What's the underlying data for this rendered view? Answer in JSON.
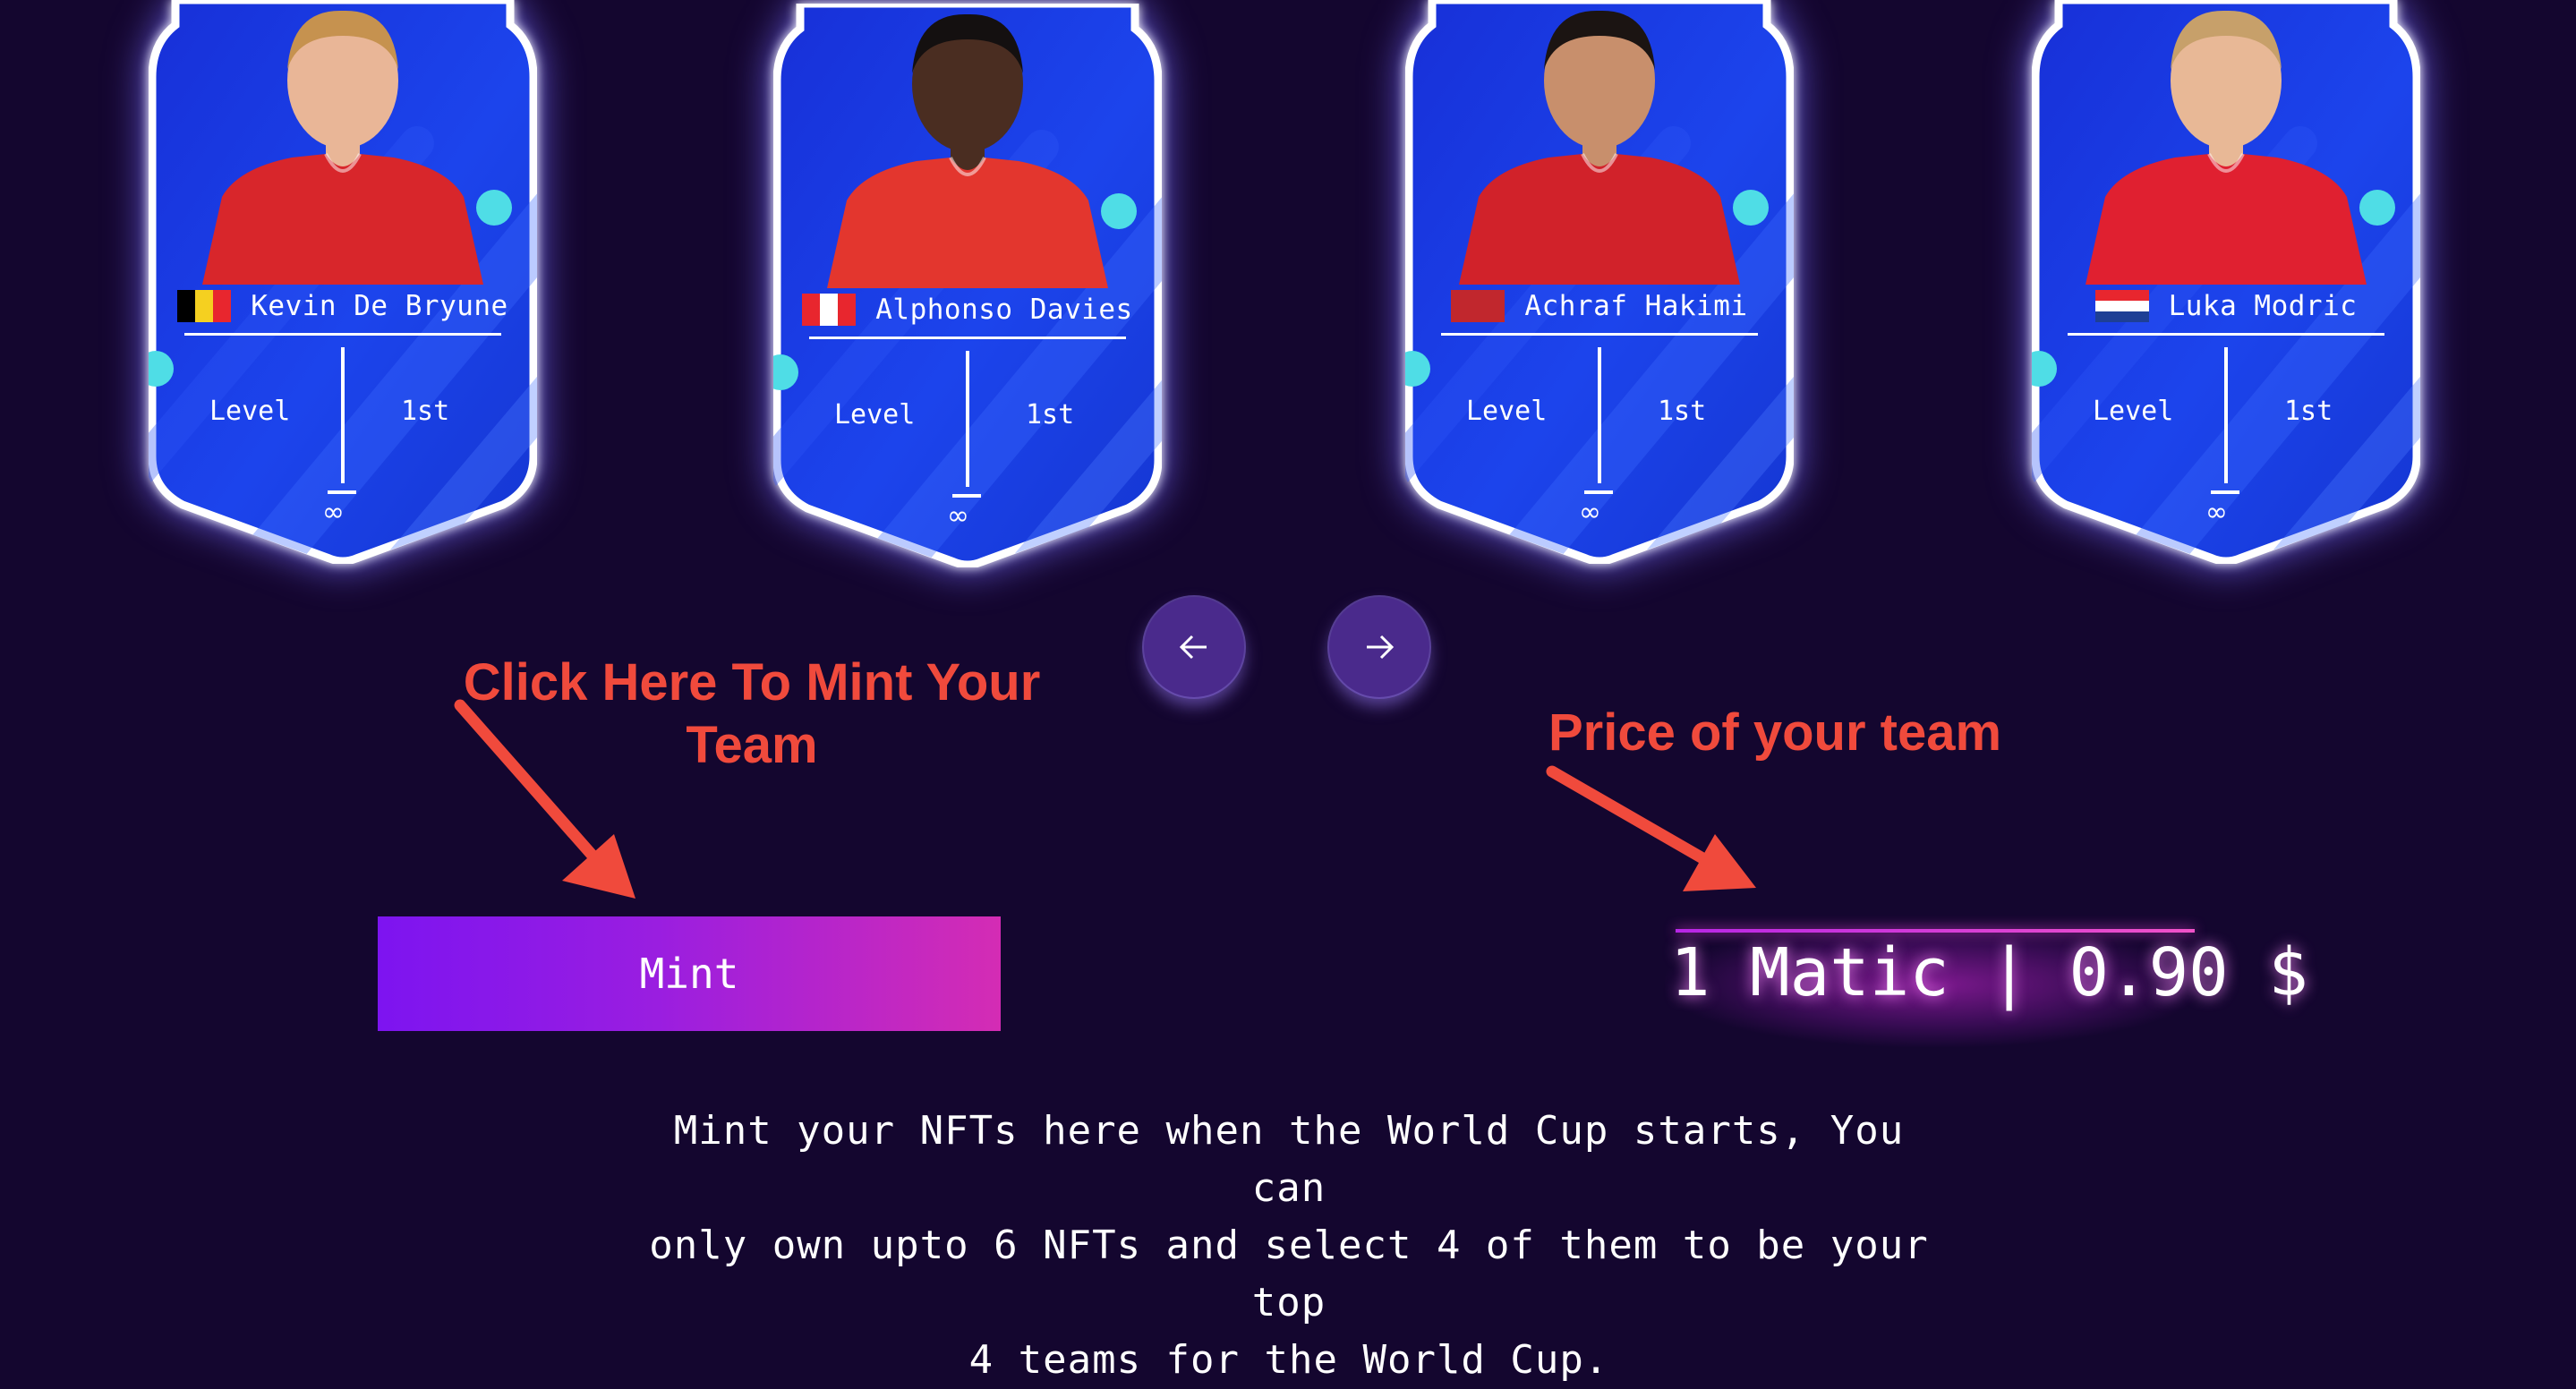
{
  "cards": [
    {
      "name": "Kevin De Bryune",
      "flag": [
        "#000000",
        "#f5d020",
        "#e8262e"
      ],
      "flag_dir": "vertical",
      "jersey": "#d8262b",
      "skin": "#e9b697",
      "hair": "#c6924f",
      "level_label": "Level",
      "rank": "1st",
      "icon": "infinity-icon"
    },
    {
      "name": "Alphonso Davies",
      "flag": [
        "#e8262e",
        "#ffffff",
        "#e8262e"
      ],
      "flag_dir": "vertical",
      "jersey": "#e3362e",
      "skin": "#4a2d21",
      "hair": "#141010",
      "level_label": "Level",
      "rank": "1st",
      "icon": "infinity-icon"
    },
    {
      "name": "Achraf Hakimi",
      "flag": [
        "#c1272d",
        "#c1272d",
        "#c1272d"
      ],
      "flag_dir": "vertical",
      "jersey": "#d1222a",
      "skin": "#c88f6c",
      "hair": "#1b1412",
      "level_label": "Level",
      "rank": "1st",
      "icon": "infinity-icon"
    },
    {
      "name": "Luka Modric",
      "flag": [
        "#e8262e",
        "#ffffff",
        "#1e3f95"
      ],
      "flag_dir": "horizontal",
      "jersey": "#e02030",
      "skin": "#e8b896",
      "hair": "#c7a06a",
      "level_label": "Level",
      "rank": "1st",
      "icon": "infinity-icon"
    }
  ],
  "nav": {
    "prev_icon": "arrow-left-icon",
    "next_icon": "arrow-right-icon"
  },
  "annotations": {
    "mint_hint_line1": "Click Here To Mint Your",
    "mint_hint_line2": "Team",
    "price_hint": "Price of your team",
    "color": "#f04a3c"
  },
  "mint": {
    "label": "Mint"
  },
  "price": {
    "text": "1 Matic | 0.90 $"
  },
  "description": {
    "line1": "Mint your NFTs here when the World Cup starts, You can",
    "line2": "only own upto 6 NFTs and select 4 of them to be your top",
    "line3": "4 teams for the World Cup."
  },
  "colors": {
    "background": "#14062f",
    "card_blue": "#1b3be0",
    "accent_purple": "#7d14f0",
    "accent_pink": "#d42cb4"
  }
}
